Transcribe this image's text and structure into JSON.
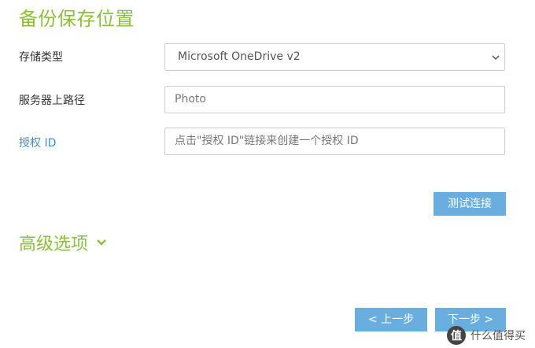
{
  "page": {
    "title": "备份保存位置"
  },
  "form": {
    "storage_type": {
      "label": "存储类型",
      "value": "Microsoft OneDrive v2"
    },
    "server_path": {
      "label": "服务器上路径",
      "value": "Photo"
    },
    "auth_id": {
      "label": "授权 ID",
      "placeholder": "点击\"授权 ID\"链接来创建一个授权 ID"
    }
  },
  "buttons": {
    "test_connection": "测试连接",
    "prev": "< 上一步",
    "next": "下一步 >"
  },
  "advanced": {
    "label": "高级选项"
  },
  "watermark": {
    "logo": "值",
    "text": "什么值得买"
  },
  "colors": {
    "accent_green": "#8cbf3f",
    "button_blue": "#6aaee0",
    "link_blue": "#3a8fd6"
  }
}
